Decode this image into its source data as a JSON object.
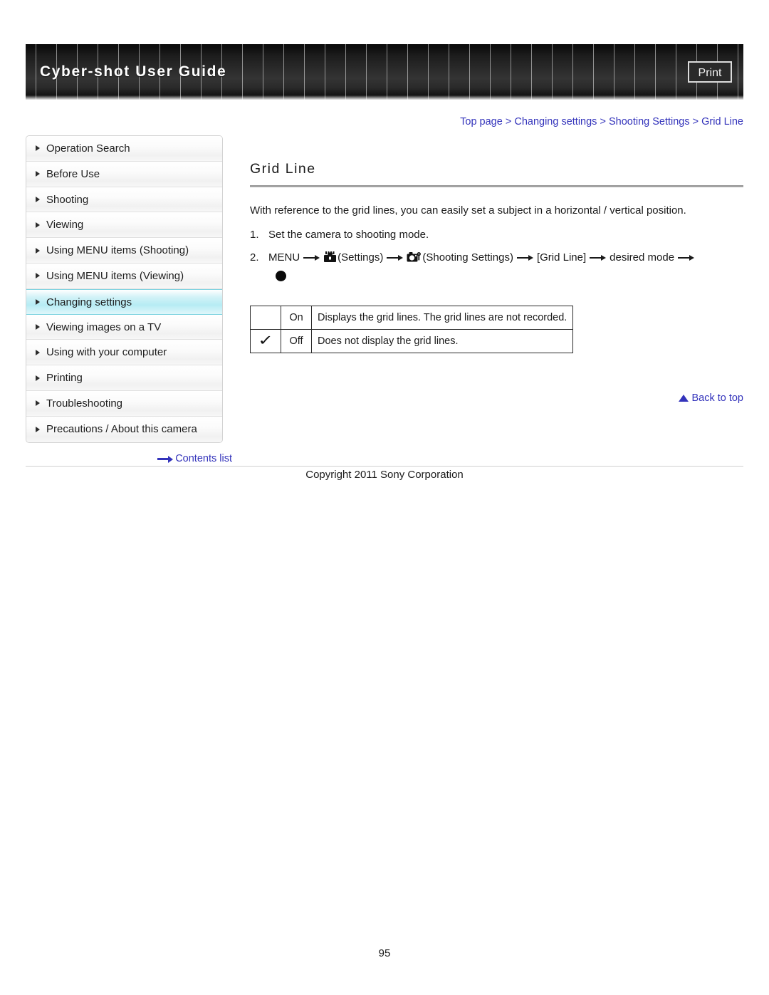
{
  "header": {
    "title": "Cyber-shot User Guide",
    "print_label": "Print"
  },
  "breadcrumb": {
    "items": [
      "Top page",
      "Changing settings",
      "Shooting Settings",
      "Grid Line"
    ],
    "separator": ">"
  },
  "sidebar": {
    "items": [
      {
        "label": "Operation Search",
        "active": false
      },
      {
        "label": "Before Use",
        "active": false
      },
      {
        "label": "Shooting",
        "active": false
      },
      {
        "label": "Viewing",
        "active": false
      },
      {
        "label": "Using MENU items (Shooting)",
        "active": false
      },
      {
        "label": "Using MENU items (Viewing)",
        "active": false
      },
      {
        "label": "Changing settings",
        "active": true
      },
      {
        "label": "Viewing images on a TV",
        "active": false
      },
      {
        "label": "Using with your computer",
        "active": false
      },
      {
        "label": "Printing",
        "active": false
      },
      {
        "label": "Troubleshooting",
        "active": false
      },
      {
        "label": "Precautions / About this camera",
        "active": false
      }
    ],
    "contents_link": "Contents list"
  },
  "main": {
    "title": "Grid Line",
    "intro": "With reference to the grid lines, you can easily set a subject in a horizontal / vertical position.",
    "steps": [
      {
        "number": "1.",
        "text": "Set the camera to shooting mode."
      }
    ],
    "step2": {
      "number": "2.",
      "menu_label": "MENU",
      "settings_label": "(Settings)",
      "shooting_settings_label": "(Shooting Settings)",
      "grid_line_label": "[Grid Line]",
      "desired_mode_label": "desired mode"
    },
    "table": {
      "rows": [
        {
          "checked": "",
          "option": "On",
          "description": "Displays the grid lines. The grid lines are not recorded."
        },
        {
          "checked": "✓",
          "option": "Off",
          "description": "Does not display the grid lines."
        }
      ]
    },
    "back_to_top": "Back to top"
  },
  "footer": {
    "copyright": "Copyright 2011 Sony Corporation",
    "page_number": "95"
  },
  "colors": {
    "link": "#3333bb",
    "active_nav": "#b6ecf4",
    "header_dark": "#2b2b2b"
  }
}
